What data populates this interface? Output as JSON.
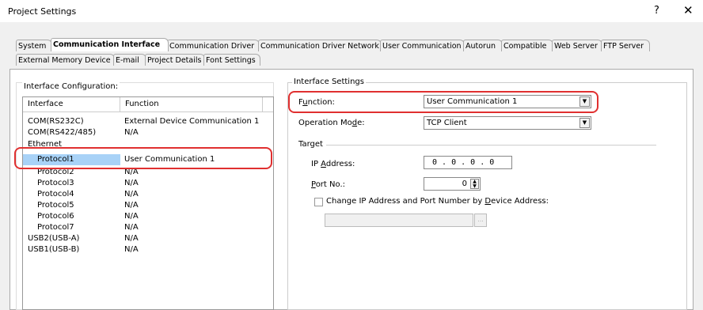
{
  "window": {
    "title": "Project Settings",
    "help": "?",
    "close": "✕"
  },
  "tabs": {
    "row1": [
      "System",
      "Communication Interface",
      "Communication Driver",
      "Communication Driver Network",
      "User Communication",
      "Autorun",
      "Compatible",
      "Web Server",
      "FTP Server"
    ],
    "row2": [
      "External Memory Device",
      "E-mail",
      "Project Details",
      "Font Settings"
    ],
    "active": "Communication Interface"
  },
  "interface_config": {
    "caption": "Interface Configuration:",
    "columns": [
      "Interface",
      "Function"
    ],
    "rows": [
      {
        "interface": "COM(RS232C)",
        "function": "External Device Communication 1"
      },
      {
        "interface": "COM(RS422/485)",
        "function": "N/A"
      },
      {
        "interface": "Ethernet",
        "function": ""
      },
      {
        "interface": "Protocol1",
        "function": "User Communication 1"
      },
      {
        "interface": "Protocol2",
        "function": "N/A"
      },
      {
        "interface": "Protocol3",
        "function": "N/A"
      },
      {
        "interface": "Protocol4",
        "function": "N/A"
      },
      {
        "interface": "Protocol5",
        "function": "N/A"
      },
      {
        "interface": "Protocol6",
        "function": "N/A"
      },
      {
        "interface": "Protocol7",
        "function": "N/A"
      },
      {
        "interface": "USB2(USB-A)",
        "function": "N/A"
      },
      {
        "interface": "USB1(USB-B)",
        "function": "N/A"
      }
    ]
  },
  "interface_settings": {
    "caption": "Interface Settings",
    "function_label_pre": "F",
    "function_label_ul": "u",
    "function_label_post": "nction:",
    "function_value": "User Communication 1",
    "mode_label_pre": "Operation Mo",
    "mode_label_ul": "d",
    "mode_label_post": "e:",
    "mode_value": "TCP Client",
    "target_label": "Target",
    "ip_label_pre": "IP ",
    "ip_label_ul": "A",
    "ip_label_post": "ddress:",
    "ip_value": "0 . 0 . 0 . 0",
    "port_label_pre": "",
    "port_label_ul": "P",
    "port_label_post": "ort No.:",
    "port_value": "0",
    "change_label_pre": "Change IP Address and Port Number by ",
    "change_label_ul": "D",
    "change_label_post": "evice Address:",
    "browse_label": "..."
  }
}
